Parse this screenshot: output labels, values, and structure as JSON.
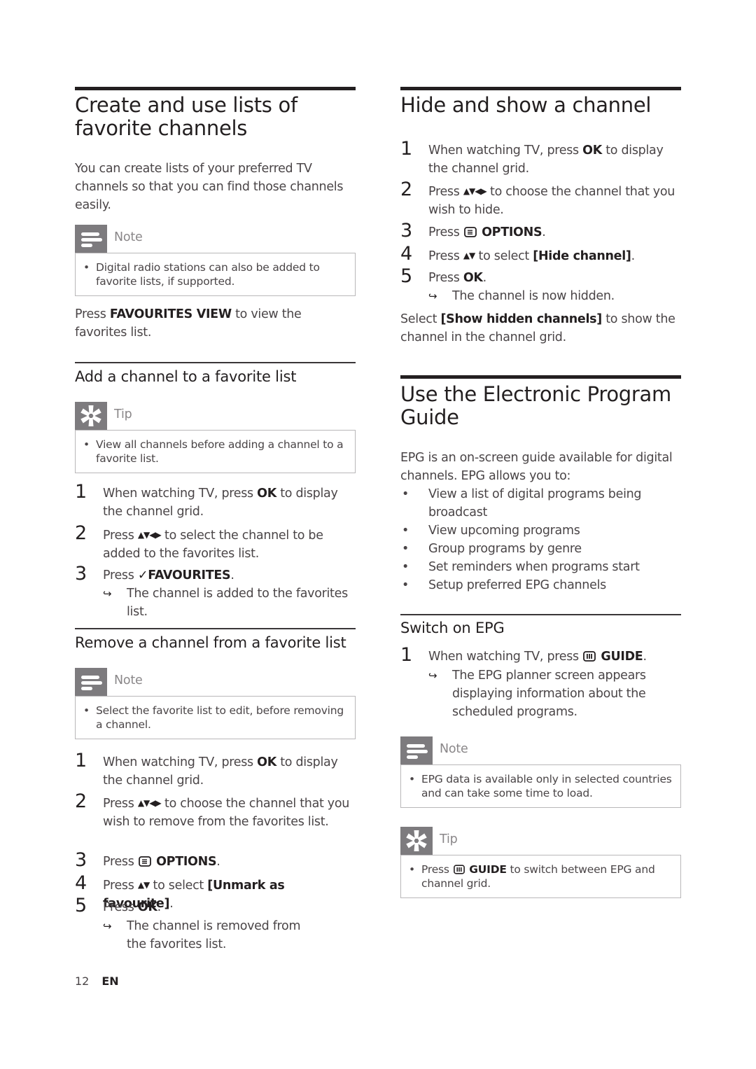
{
  "left": {
    "title": "Create and use lists of favorite channels",
    "intro": "You can create lists of your preferred TV channels so that you can find those channels easily.",
    "note1": {
      "label": "Note",
      "icon": "note-icon",
      "text": "Digital radio stations can also be added to favorite lists, if supported."
    },
    "view_para": {
      "pre": "Press ",
      "key": "FAVOURITES VIEW",
      "post": " to view the favorites list."
    },
    "add_section": {
      "title": "Add a channel to a favorite list",
      "tip": {
        "label": "Tip",
        "icon": "tip-icon",
        "text": "View all channels before adding a channel to a favorite list."
      },
      "steps": [
        {
          "num": "1",
          "pre": "When watching TV, press ",
          "key": "OK",
          "post": " to display the channel grid."
        },
        {
          "num": "2",
          "pre": "Press ",
          "arrows": "▲▼◀▶",
          "post": " to select the channel to be added to the favorites list."
        },
        {
          "num": "3",
          "pre": "Press ",
          "key": "✓FAVOURITES",
          "post": "."
        }
      ],
      "result": "The channel is added to the favorites list."
    },
    "remove_section": {
      "title": "Remove a channel from a favorite list",
      "note": {
        "label": "Note",
        "icon": "note-icon",
        "text": "Select the favorite list to edit, before removing a channel."
      },
      "steps": [
        {
          "num": "1",
          "pre": "When watching TV, press ",
          "key": "OK",
          "post": " to display the channel grid."
        },
        {
          "num": "2",
          "pre": "Press ",
          "arrows": "▲▼◀▶",
          "post": " to choose the channel that you wish to remove from the favorites list."
        },
        {
          "num": "3",
          "pre": "Press ",
          "key": "OPTIONS",
          "post": "."
        },
        {
          "num": "4",
          "pre": "Press ",
          "arrows": "▲▼",
          "mid": " to select ",
          "key": "[Unmark as favourite]",
          "post": "."
        },
        {
          "num": "5",
          "pre": "Press ",
          "key": "OK",
          "post": "."
        }
      ],
      "result": "The channel is removed from the favorites list."
    }
  },
  "right": {
    "hide_section": {
      "title": "Hide and show a channel",
      "steps": [
        {
          "num": "1",
          "pre": "When watching TV, press ",
          "key": "OK",
          "post": " to display the channel grid."
        },
        {
          "num": "2",
          "pre": "Press ",
          "arrows": "▲▼◀▶",
          "post": " to choose the channel that you wish to hide."
        },
        {
          "num": "3",
          "pre": "Press ",
          "key": "OPTIONS",
          "post": "."
        },
        {
          "num": "4",
          "pre": "Press ",
          "arrows": "▲▼",
          "mid": " to select ",
          "key": "[Hide channel]",
          "post": "."
        },
        {
          "num": "5",
          "pre": "Press ",
          "key": "OK",
          "post": "."
        }
      ],
      "result": "The channel is now hidden.",
      "show_para": {
        "pre": "Select ",
        "key": "[Show hidden channels]",
        "post": " to show the channel in the channel grid."
      }
    },
    "epg_section": {
      "title": "Use the Electronic Program Guide",
      "intro": "EPG is an on-screen guide available for digital channels. EPG allows you to:",
      "bullets": [
        "View a list of digital programs being broadcast",
        "View upcoming programs",
        "Group programs by genre",
        "Set reminders when programs start",
        "Setup preferred EPG channels"
      ],
      "switch": {
        "title": "Switch on EPG",
        "step": {
          "num": "1",
          "pre": "When watching TV, press ",
          "key": "GUIDE",
          "post": "."
        },
        "result": "The EPG planner screen appears displaying information about the scheduled programs."
      },
      "note": {
        "label": "Note",
        "icon": "note-icon",
        "text": "EPG data is available only in selected countries and can take some time to load."
      },
      "tip": {
        "label": "Tip",
        "icon": "tip-icon",
        "pre": "Press ",
        "key": "GUIDE",
        "post": " to switch between EPG and channel grid."
      }
    }
  },
  "footer": {
    "page": "12",
    "lang": "EN"
  },
  "colors": {
    "icon_bg": "#7d7b7e",
    "heading": "#231f20",
    "body_text": "#4a4547",
    "box_border": "#b9b7b9"
  }
}
